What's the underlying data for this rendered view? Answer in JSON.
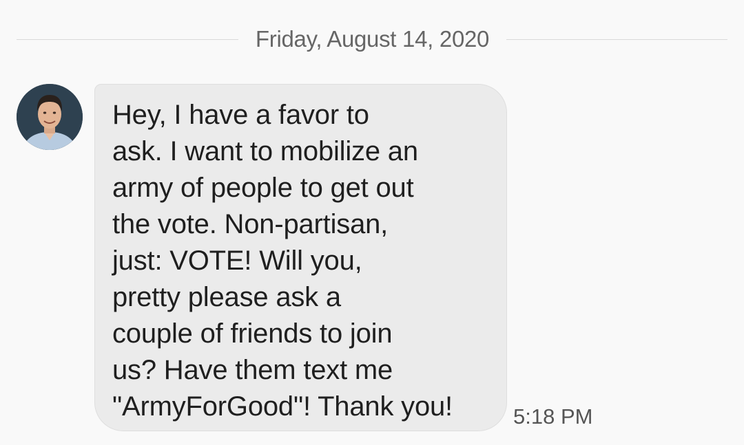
{
  "conversation": {
    "date_separator": "Friday, August 14, 2020",
    "message": {
      "text": "Hey, I have a favor to\nask. I want to mobilize an\narmy of people to get out\nthe vote. Non-partisan,\njust: VOTE! Will you,\npretty please ask a\ncouple of friends to join\nus? Have them text me\n\"ArmyForGood\"! Thank you!",
      "time": "5:18 PM",
      "sender_avatar": "contact-photo"
    }
  },
  "colors": {
    "background": "#f9f9f9",
    "bubble": "#ebebeb",
    "message_text": "#1f1f1f",
    "meta_text": "#666666"
  }
}
